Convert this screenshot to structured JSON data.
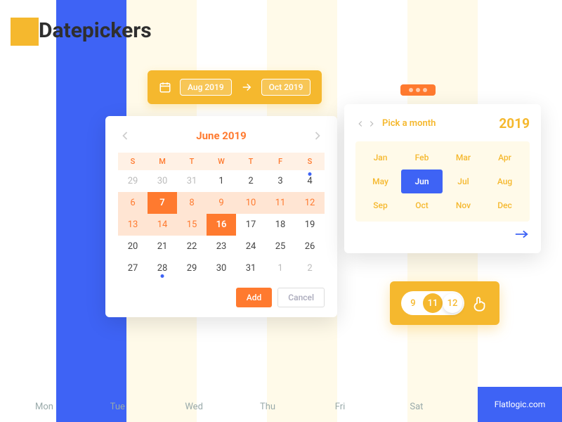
{
  "title": "Datepickers",
  "colors": {
    "accent_yellow": "#f5b82e",
    "accent_orange": "#ff7a2f",
    "accent_blue": "#3e63f5"
  },
  "range_picker": {
    "from": "Aug 2019",
    "to": "Oct 2019"
  },
  "calendar": {
    "title": "June 2019",
    "day_headers": [
      "S",
      "M",
      "T",
      "W",
      "T",
      "F",
      "S"
    ],
    "days": [
      {
        "n": "29",
        "mute": true
      },
      {
        "n": "30",
        "mute": true
      },
      {
        "n": "31",
        "mute": true
      },
      {
        "n": "1"
      },
      {
        "n": "2"
      },
      {
        "n": "3"
      },
      {
        "n": "4",
        "dot": true
      },
      {
        "n": "6",
        "rng": true
      },
      {
        "n": "7",
        "sel": true
      },
      {
        "n": "8",
        "rng": true
      },
      {
        "n": "9",
        "rng": true
      },
      {
        "n": "10",
        "rng": true
      },
      {
        "n": "11",
        "rng": true
      },
      {
        "n": "12",
        "rng": true
      },
      {
        "n": "13",
        "rng": true
      },
      {
        "n": "14",
        "rng": true
      },
      {
        "n": "15",
        "rng": true
      },
      {
        "n": "16",
        "sel": true
      },
      {
        "n": "17"
      },
      {
        "n": "18"
      },
      {
        "n": "19"
      },
      {
        "n": "20"
      },
      {
        "n": "21"
      },
      {
        "n": "22"
      },
      {
        "n": "23"
      },
      {
        "n": "24"
      },
      {
        "n": "25"
      },
      {
        "n": "26"
      },
      {
        "n": "27"
      },
      {
        "n": "28",
        "dotb": true
      },
      {
        "n": "29"
      },
      {
        "n": "30"
      },
      {
        "n": "31"
      },
      {
        "n": "1",
        "mute": true
      },
      {
        "n": "2",
        "mute": true
      }
    ],
    "add_label": "Add",
    "cancel_label": "Cancel"
  },
  "month_picker": {
    "title": "Pick a month",
    "year": "2019",
    "months": [
      {
        "l": "Jan"
      },
      {
        "l": "Feb"
      },
      {
        "l": "Mar"
      },
      {
        "l": "Apr"
      },
      {
        "l": "May"
      },
      {
        "l": "Jun",
        "sel": true
      },
      {
        "l": "Jul"
      },
      {
        "l": "Aug"
      },
      {
        "l": "Sep"
      },
      {
        "l": "Oct"
      },
      {
        "l": "Nov"
      },
      {
        "l": "Dec"
      }
    ]
  },
  "slider": {
    "values": [
      "9",
      "11",
      "12"
    ]
  },
  "footer": {
    "days": [
      "Mon",
      "Tue",
      "Wed",
      "Thu",
      "Fri",
      "Sat"
    ],
    "brand": "Flatlogic.com"
  }
}
